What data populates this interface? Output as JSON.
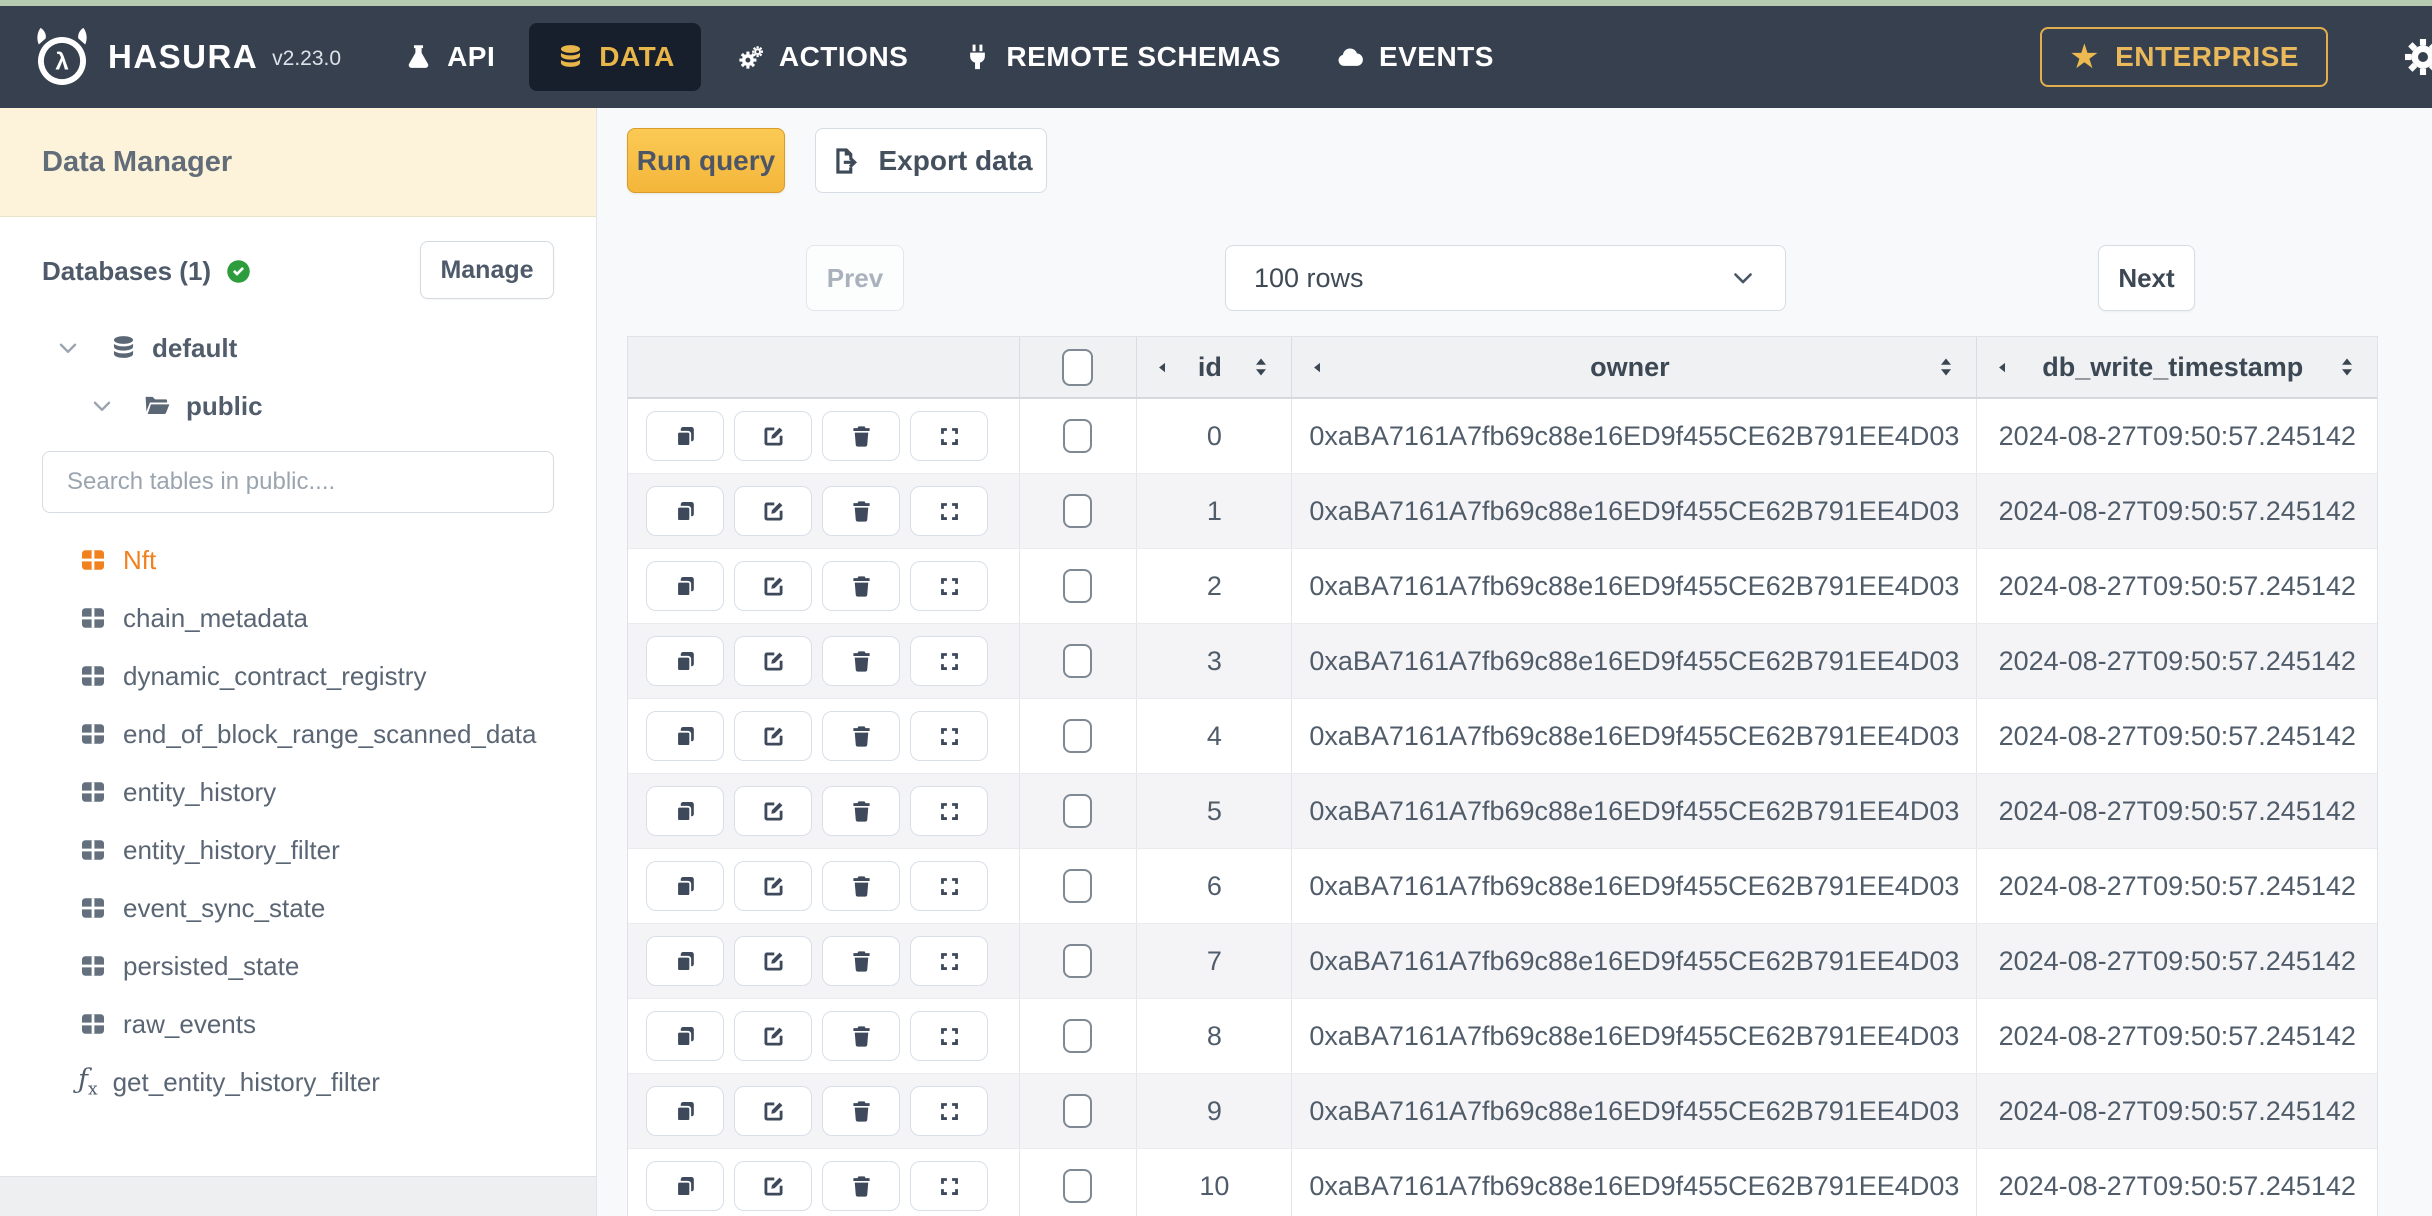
{
  "topbar": {
    "brand": "HASURA",
    "version": "v2.23.0",
    "nav": [
      {
        "label": "API",
        "icon": "flask-icon",
        "active": false
      },
      {
        "label": "DATA",
        "icon": "database-icon",
        "active": true
      },
      {
        "label": "ACTIONS",
        "icon": "gears-icon",
        "active": false
      },
      {
        "label": "REMOTE SCHEMAS",
        "icon": "plug-icon",
        "active": false
      },
      {
        "label": "EVENTS",
        "icon": "cloud-icon",
        "active": false
      }
    ],
    "enterprise_label": "ENTERPRISE"
  },
  "sidebar": {
    "title": "Data Manager",
    "databases_label": "Databases (1)",
    "manage_label": "Manage",
    "tree": {
      "database": "default",
      "schema": "public"
    },
    "search_placeholder": "Search tables in public....",
    "tables": [
      {
        "label": "Nft",
        "icon": "table-icon",
        "selected": true
      },
      {
        "label": "chain_metadata",
        "icon": "table-icon",
        "selected": false
      },
      {
        "label": "dynamic_contract_registry",
        "icon": "table-icon",
        "selected": false
      },
      {
        "label": "end_of_block_range_scanned_data",
        "icon": "table-icon",
        "selected": false
      },
      {
        "label": "entity_history",
        "icon": "table-icon",
        "selected": false
      },
      {
        "label": "entity_history_filter",
        "icon": "table-icon",
        "selected": false
      },
      {
        "label": "event_sync_state",
        "icon": "table-icon",
        "selected": false
      },
      {
        "label": "persisted_state",
        "icon": "table-icon",
        "selected": false
      },
      {
        "label": "raw_events",
        "icon": "table-icon",
        "selected": false
      },
      {
        "label": "get_entity_history_filter",
        "icon": "function-icon",
        "selected": false
      }
    ]
  },
  "toolbar": {
    "run_query_label": "Run query",
    "export_data_label": "Export data"
  },
  "pagination": {
    "prev_label": "Prev",
    "rows_per_page": "100 rows",
    "next_label": "Next"
  },
  "grid": {
    "columns": [
      {
        "key": "id",
        "label": "id"
      },
      {
        "key": "owner",
        "label": "owner"
      },
      {
        "key": "db_write_timestamp",
        "label": "db_write_timestamp"
      }
    ],
    "rows": [
      {
        "id": "0",
        "owner": "0xaBA7161A7fb69c88e16ED9f455CE62B791EE4D03",
        "db_write_timestamp": "2024-08-27T09:50:57.245142"
      },
      {
        "id": "1",
        "owner": "0xaBA7161A7fb69c88e16ED9f455CE62B791EE4D03",
        "db_write_timestamp": "2024-08-27T09:50:57.245142"
      },
      {
        "id": "2",
        "owner": "0xaBA7161A7fb69c88e16ED9f455CE62B791EE4D03",
        "db_write_timestamp": "2024-08-27T09:50:57.245142"
      },
      {
        "id": "3",
        "owner": "0xaBA7161A7fb69c88e16ED9f455CE62B791EE4D03",
        "db_write_timestamp": "2024-08-27T09:50:57.245142"
      },
      {
        "id": "4",
        "owner": "0xaBA7161A7fb69c88e16ED9f455CE62B791EE4D03",
        "db_write_timestamp": "2024-08-27T09:50:57.245142"
      },
      {
        "id": "5",
        "owner": "0xaBA7161A7fb69c88e16ED9f455CE62B791EE4D03",
        "db_write_timestamp": "2024-08-27T09:50:57.245142"
      },
      {
        "id": "6",
        "owner": "0xaBA7161A7fb69c88e16ED9f455CE62B791EE4D03",
        "db_write_timestamp": "2024-08-27T09:50:57.245142"
      },
      {
        "id": "7",
        "owner": "0xaBA7161A7fb69c88e16ED9f455CE62B791EE4D03",
        "db_write_timestamp": "2024-08-27T09:50:57.245142"
      },
      {
        "id": "8",
        "owner": "0xaBA7161A7fb69c88e16ED9f455CE62B791EE4D03",
        "db_write_timestamp": "2024-08-27T09:50:57.245142"
      },
      {
        "id": "9",
        "owner": "0xaBA7161A7fb69c88e16ED9f455CE62B791EE4D03",
        "db_write_timestamp": "2024-08-27T09:50:57.245142"
      },
      {
        "id": "10",
        "owner": "0xaBA7161A7fb69c88e16ED9f455CE62B791EE4D03",
        "db_write_timestamp": "2024-08-27T09:50:57.245142"
      }
    ]
  },
  "colors": {
    "nav_bg": "#36404f",
    "accent_yellow": "#f6bb43",
    "enterprise_gold": "#e9b64a",
    "selected_table_orange": "#f1811f",
    "success_green": "#2d9c3c",
    "sidebar_title_bg": "#fcf3da"
  }
}
